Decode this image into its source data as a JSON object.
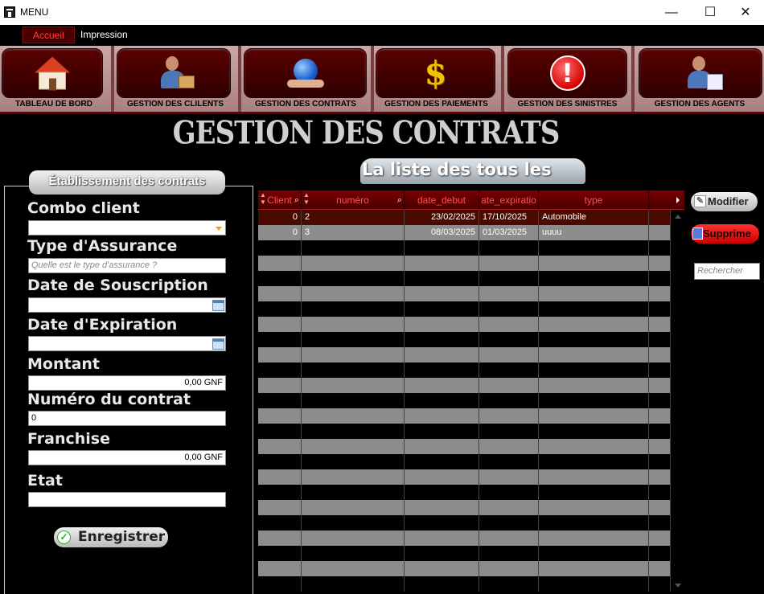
{
  "window": {
    "title": "MENU",
    "minimize": "—",
    "maximize": "☐",
    "close": "✕"
  },
  "menu": {
    "items": [
      "Accueil",
      "Impression"
    ]
  },
  "ribbon": [
    {
      "label": "TABLEAU DE BORD",
      "icon": "house-icon"
    },
    {
      "label": "GESTION DES CLILENTS",
      "icon": "client-icon"
    },
    {
      "label": "GESTION DES CONTRATS",
      "icon": "globe-hand-icon"
    },
    {
      "label": "GESTION DES PAIEMENTS",
      "icon": "dollar-icon"
    },
    {
      "label": "GESTION DES SINISTRES",
      "icon": "alert-icon"
    },
    {
      "label": "GESTION DES AGENTS",
      "icon": "agent-icon"
    }
  ],
  "page_title": "GESTION DES CONTRATS",
  "form": {
    "header": "Établissement des contrats",
    "combo_client_label": "Combo client",
    "combo_client_value": "",
    "type_label": "Type d'Assurance",
    "type_placeholder": "Quelle est le type d'assurance ?",
    "date_souscription_label": "Date de Souscription",
    "date_souscription_value": "",
    "date_expiration_label": "Date d'Expiration",
    "date_expiration_value": "",
    "montant_label": "Montant",
    "montant_value": "0,00 GNF",
    "numero_label": "Numéro du contrat",
    "numero_value": "0",
    "franchise_label": "Franchise",
    "franchise_value": "0,00 GNF",
    "etat_label": "Etat",
    "etat_value": "",
    "save_label": "Enregistrer"
  },
  "list": {
    "title": "La liste des tous les",
    "columns": [
      "Client",
      "numéro",
      "date_debut",
      "ate_expiratio",
      "type"
    ],
    "rows": [
      [
        "0",
        "2",
        "23/02/2025",
        "17/10/2025",
        "Automobile"
      ],
      [
        "0",
        "3",
        "08/03/2025",
        "01/03/2025",
        "uuuu"
      ]
    ]
  },
  "actions": {
    "modify_label": "Modifier",
    "delete_label": "Supprime",
    "search_placeholder": "Rechercher"
  },
  "colors": {
    "accent": "#6a0000",
    "row_selected": "#4a0a00",
    "row_alt": "#8c8c8c"
  }
}
